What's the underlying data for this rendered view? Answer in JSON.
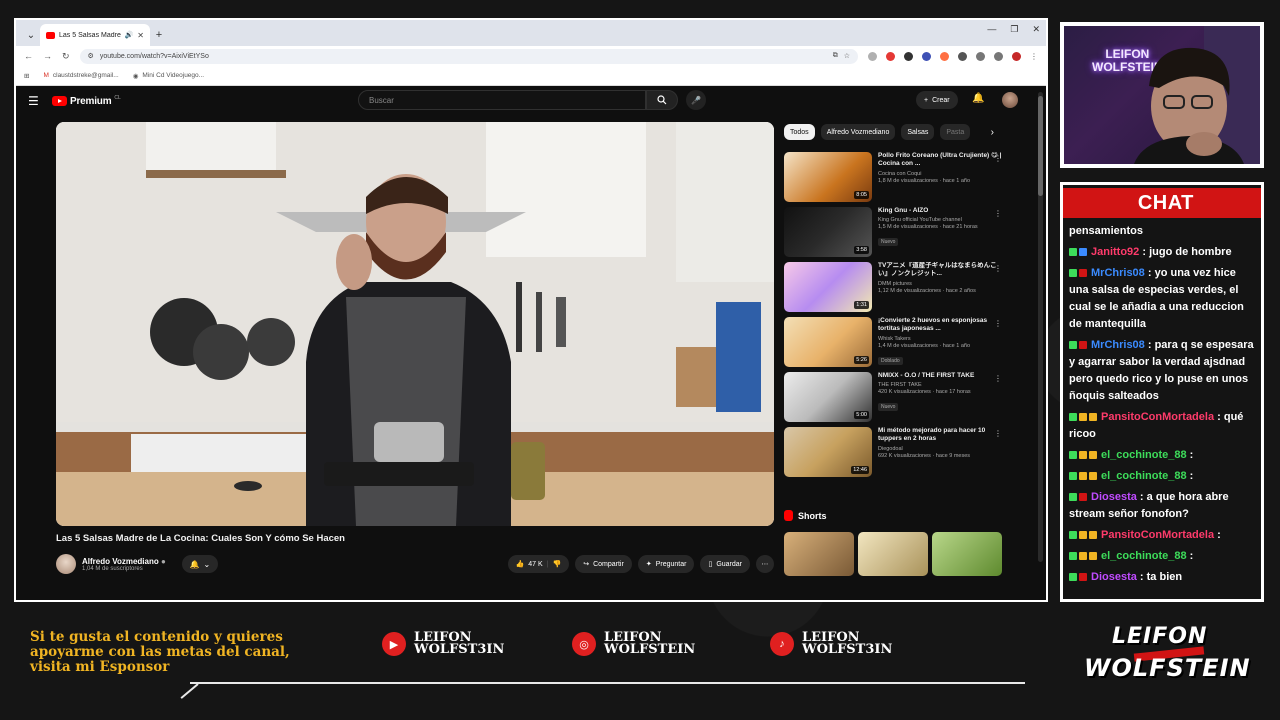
{
  "browser": {
    "tab_title": "Las 5 Salsas Madre de La Coc",
    "url": "youtube.com/watch?v=AixiViEtYSo",
    "bookmarks": [
      "claustdstreke@gmail...",
      "Mini Cd Videojuego..."
    ]
  },
  "youtube": {
    "logo_text": "Premium",
    "logo_country": "CL",
    "search_placeholder": "Buscar",
    "create_label": "Crear",
    "video": {
      "title": "Las 5 Salsas Madre de La Cocina: Cuales Son Y cómo Se Hacen",
      "channel": "Alfredo Vozmediano",
      "subscribers": "1,04 M de suscriptores",
      "likes": "47 K",
      "share_label": "Compartir",
      "ask_label": "Preguntar",
      "save_label": "Guardar"
    },
    "chips": [
      "Todos",
      "Alfredo Vozmediano",
      "Salsas",
      "Pasta"
    ],
    "recommendations": [
      {
        "title": "Pollo Frito Coreano (Ultra Crujiente) 😋 | Cocina con ...",
        "channel": "Cocina con Coqui",
        "views": "1,8 M de visualizaciones · hace 1 año",
        "duration": "8:05",
        "badge": ""
      },
      {
        "title": "King Gnu - AIZO",
        "channel": "King Gnu official YouTube channel",
        "views": "1,5 M de visualizaciones · hace 21 horas",
        "duration": "3:58",
        "badge": "Nuevo"
      },
      {
        "title": "TVアニメ『道産子ギャルはなまらめんこい』ノンクレジット...",
        "channel": "DMM pictures",
        "views": "1,12 M de visualizaciones · hace 2 años",
        "duration": "1:31",
        "badge": ""
      },
      {
        "title": "¡Convierte 2 huevos en esponjosas tortitas japonesas ...",
        "channel": "Whisk Takers",
        "views": "1,4 M de visualizaciones · hace 1 año",
        "duration": "5:26",
        "badge": "Doblado"
      },
      {
        "title": "NMIXX - O.O / THE FIRST TAKE",
        "channel": "THE FIRST TAKE",
        "views": "420 K visualizaciones · hace 17 horas",
        "duration": "5:00",
        "badge": "Nuevo"
      },
      {
        "title": "Mi método mejorado para hacer 10 tuppers en 2 horas",
        "channel": "Diegodoal",
        "views": "692 K visualizaciones · hace 9 meses",
        "duration": "12:46",
        "badge": ""
      }
    ],
    "shorts_label": "Shorts"
  },
  "webcam": {
    "neon_line1": "LEIFON",
    "neon_line2": "WOLFSTEIN"
  },
  "chat": {
    "header": "CHAT",
    "messages": [
      {
        "user": "",
        "text": "pensamientos",
        "color": "#ffffff"
      },
      {
        "user": "Janitto92",
        "text": ": jugo de hombre",
        "color": "#ff3b6b"
      },
      {
        "user": "MrChris08",
        "text": ": yo una vez hice una salsa de especias verdes, el cual se le añadia a una reduccion de mantequilla",
        "color": "#3b8bff"
      },
      {
        "user": "MrChris08",
        "text": ": para q se espesara y agarrar sabor la verdad ajsdnad pero quedo rico y lo puse en unos ñoquis salteados",
        "color": "#3b8bff"
      },
      {
        "user": "PansitoConMortadela",
        "text": ": qué ricoo",
        "color": "#ff3b6b"
      },
      {
        "user": "el_cochinote_88",
        "text": ":",
        "color": "#3ddc5a"
      },
      {
        "user": "el_cochinote_88",
        "text": ":",
        "color": "#3ddc5a"
      },
      {
        "user": "Diosesta",
        "text": ": a que hora abre stream señor fonofon?",
        "color": "#c04bff"
      },
      {
        "user": "PansitoConMortadela",
        "text": ":",
        "color": "#ff3b6b"
      },
      {
        "user": "el_cochinote_88",
        "text": ":",
        "color": "#3ddc5a"
      },
      {
        "user": "Diosesta",
        "text": ": ta bien",
        "color": "#c04bff"
      }
    ]
  },
  "bottom": {
    "sponsor_lines": [
      "Si te gusta el contenido y quieres",
      "apoyarme con las metas del canal,",
      "visita mi Esponsor"
    ],
    "socials": [
      {
        "icon": "youtube-icon",
        "line1": "LEIFON",
        "line2": "WOLFST3IN"
      },
      {
        "icon": "instagram-icon",
        "line1": "LEIFON",
        "line2": "WOLFSTEIN"
      },
      {
        "icon": "tiktok-icon",
        "line1": "LEIFON",
        "line2": "WOLFST3IN"
      }
    ],
    "brand_line1": "LEIFON",
    "brand_line2": "WOLFSTEIN"
  }
}
